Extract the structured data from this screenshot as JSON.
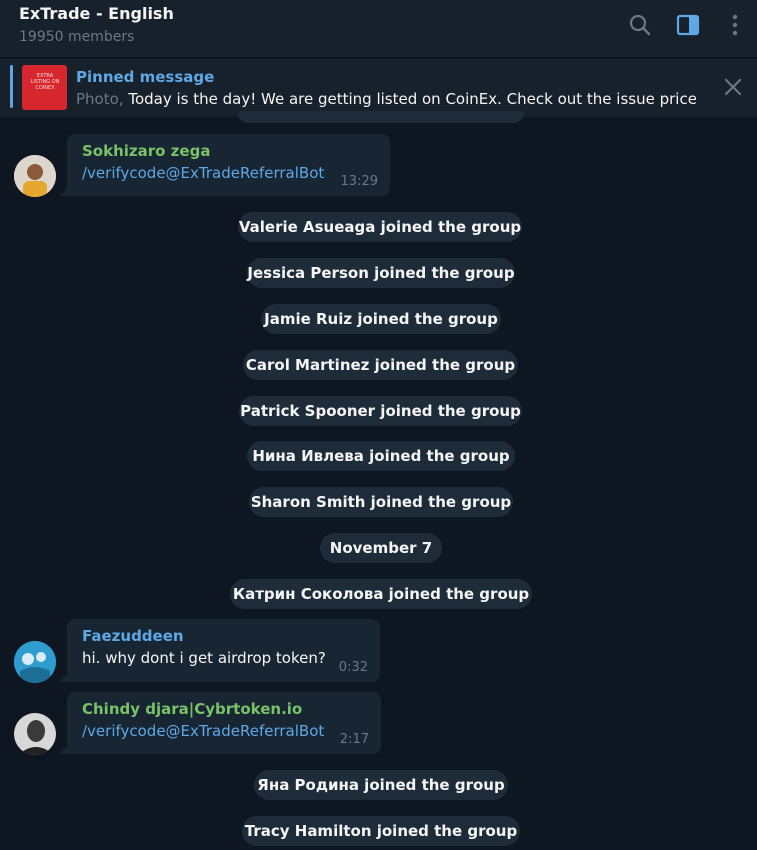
{
  "header": {
    "title": "ExTrade - English",
    "subtitle": "19950 members",
    "icons": [
      "search-icon",
      "sidebar-toggle-icon",
      "more-icon"
    ]
  },
  "pinned": {
    "title": "Pinned message",
    "kind": "Photo,",
    "text": "Today is the day! We are getting listed on CoinEx. Check out the issue price,...",
    "thumb_text": "EXTRA LISTING ON COINEX"
  },
  "messages": [
    {
      "sender": "Sokhizaro zega",
      "text": "/verifycode@ExTradeReferralBot",
      "time": "13:29",
      "sender_color": "#79c267"
    },
    {
      "sender": "Faezuddeen",
      "text": "hi. why dont i get airdrop token?",
      "time": "0:32",
      "sender_color": "#5ea8e6"
    },
    {
      "sender": "Chindy djara|Cybrtoken.io",
      "text": "/verifycode@ExTradeReferralBot",
      "time": "2:17",
      "sender_color": "#79c267"
    }
  ],
  "services": [
    "Valerie Asueaga joined the group",
    "Jessica Person joined the group",
    "Jamie Ruiz joined the group",
    "Carol Martinez joined the group",
    "Patrick Spooner joined the group",
    "Нина Ивлева joined the group",
    "Sharon Smith joined the group",
    "November 7",
    "Катрин Соколова joined the group",
    "Яна Родина joined the group",
    "Tracy Hamilton joined the group"
  ],
  "colors": {
    "background": "#0e1621",
    "panel": "#17212b",
    "bubble": "#182533",
    "accent": "#5ea8e6"
  }
}
